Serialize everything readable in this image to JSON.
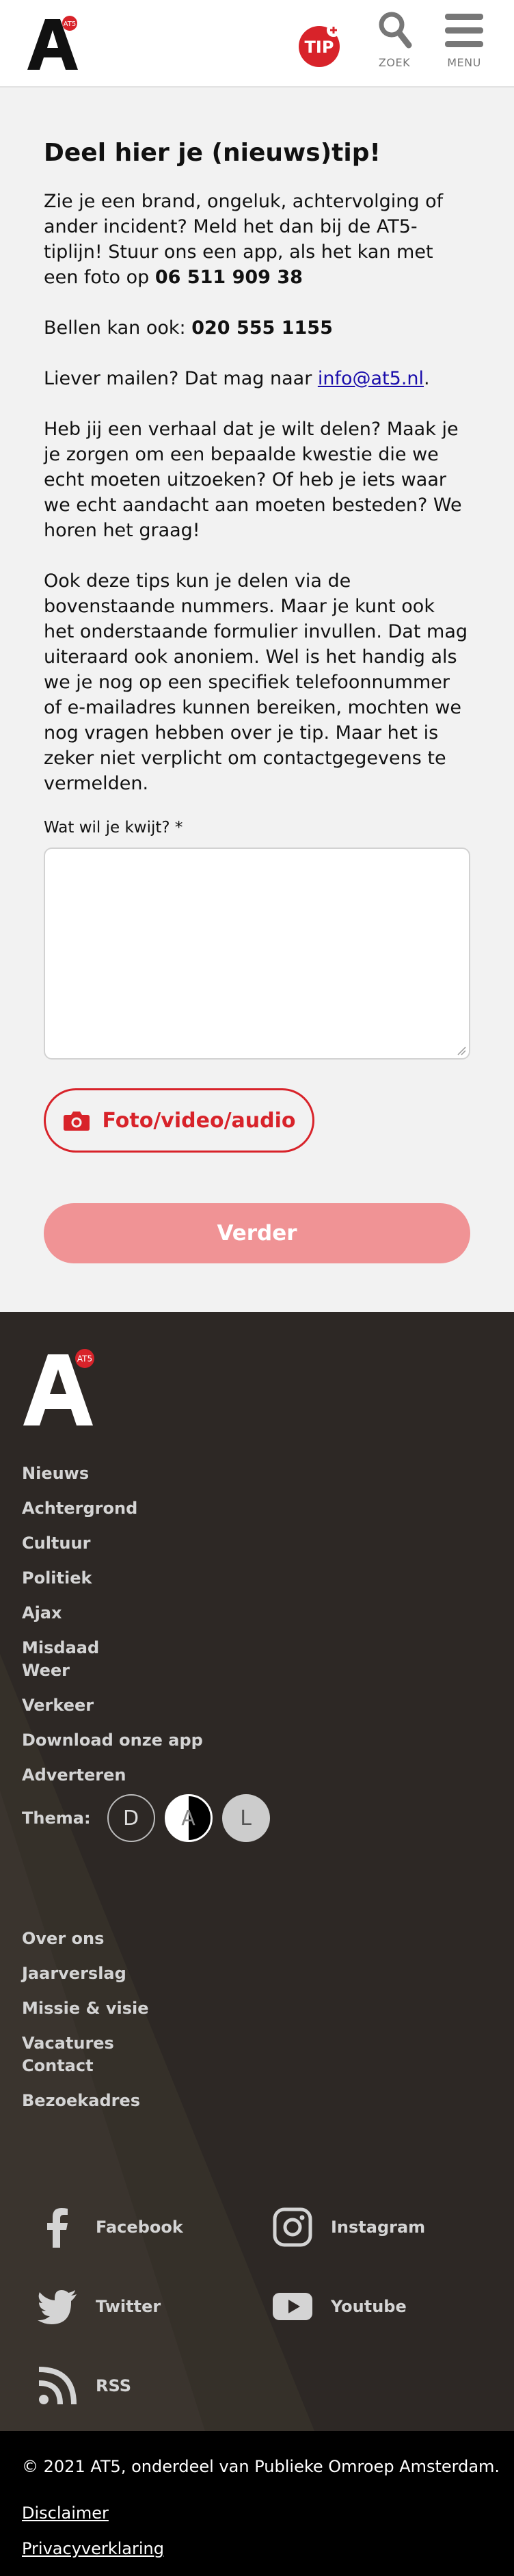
{
  "header": {
    "logo_badge": "AT5",
    "tip_label": "TIP",
    "search_label": "ZOEK",
    "menu_label": "MENU"
  },
  "main": {
    "title": "Deel hier je (nieuws)tip!",
    "intro": "Zie je een brand, ongeluk, achtervolging of ander incident? Meld het dan bij de AT5-tiplijn! Stuur ons een app, als het kan met een foto op ",
    "app_number": "06 511 909 38",
    "call_prefix": "Bellen kan ook: ",
    "call_number": "020 555 1155",
    "mail_prefix": "Liever mailen? Dat mag naar ",
    "mail_address": "info@at5.nl",
    "mail_suffix": ".",
    "story": "Heb jij een verhaal dat je wilt delen? Maak je je zorgen om een bepaalde kwestie die we echt moeten uitzoeken? Of heb je iets waar we echt aandacht aan moeten besteden? We horen het graag!",
    "anon": "Ook deze tips kun je delen via de bovenstaande nummers. Maar je kunt ook het onderstaande formulier invullen. Dat mag uiteraard ook anoniem. Wel is het handig als we je nog op een specifiek telefoonnummer of e-mailadres kunnen bereiken, mochten we nog vragen hebben over je tip. Maar het is zeker niet verplicht om contactgegevens te vermelden.",
    "question_label": "Wat wil je kwijt? *",
    "textarea_value": "",
    "media_button": "Foto/video/audio",
    "submit_button": "Verder"
  },
  "footer": {
    "logo_badge": "AT5",
    "nav": [
      "Nieuws",
      "Achtergrond",
      "Cultuur",
      "Politiek",
      "Ajax",
      "Misdaad",
      "Weer",
      "Verkeer",
      "Download onze app",
      "Adverteren"
    ],
    "theme_label": "Thema:",
    "theme_options": [
      "D",
      "A",
      "L"
    ],
    "nav2": [
      "Over ons",
      "Jaarverslag",
      "Missie & visie",
      "Vacatures",
      "Contact",
      "Bezoekadres"
    ],
    "social": [
      "Facebook",
      "Instagram",
      "Twitter",
      "Youtube",
      "RSS"
    ],
    "copyright": "© 2021 AT5, onderdeel van Publieke Omroep Amsterdam.",
    "disclaimer": "Disclaimer",
    "privacy": "Privacyverklaring"
  },
  "colors": {
    "brand_red": "#d8232a",
    "submit_disabled": "#f09395",
    "footer_bg": "#2d2825",
    "bottom_bg": "#000000"
  }
}
